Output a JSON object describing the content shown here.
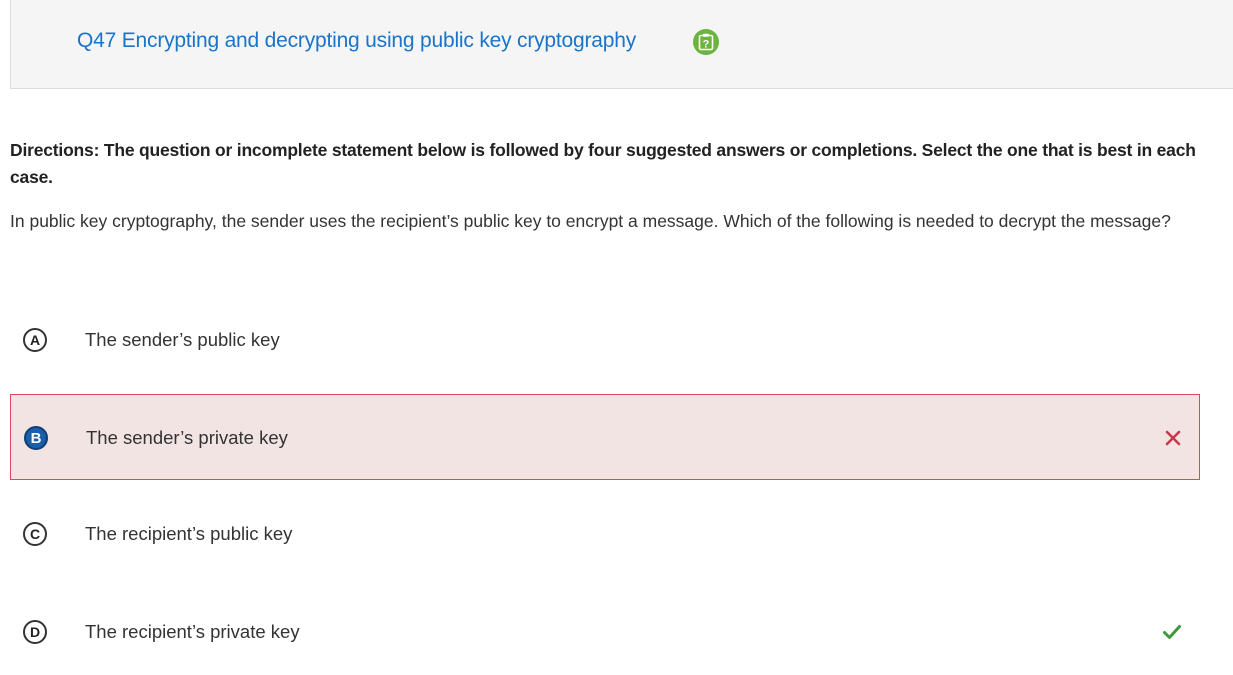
{
  "header": {
    "title": "Q47 Encrypting and decrypting using public key cryptography",
    "help_icon": "help-question-icon",
    "help_icon_glyph": "?",
    "help_color": "#6cb33f",
    "title_color": "#1a74c9"
  },
  "directions": "Directions: The question or incomplete statement below is followed by four suggested answers or completions. Select the one that is best in each case.",
  "question": "In public key cryptography, the sender uses the recipient’s public key to encrypt a message. Which of the following is needed to decrypt the message?",
  "options": [
    {
      "letter": "A",
      "text": "The sender’s public key",
      "selected": false,
      "result": "none"
    },
    {
      "letter": "B",
      "text": "The sender’s private key",
      "selected": true,
      "result": "incorrect"
    },
    {
      "letter": "C",
      "text": "The recipient’s public key",
      "selected": false,
      "result": "none"
    },
    {
      "letter": "D",
      "text": "The recipient’s private key",
      "selected": false,
      "result": "correct"
    }
  ],
  "colors": {
    "incorrect_bg": "#f3e4e4",
    "incorrect_border": "#d94b5a",
    "incorrect_mark": "#c9384a",
    "correct_mark": "#3d9a3d",
    "selected_letter_bg": "#1a5fa8"
  }
}
